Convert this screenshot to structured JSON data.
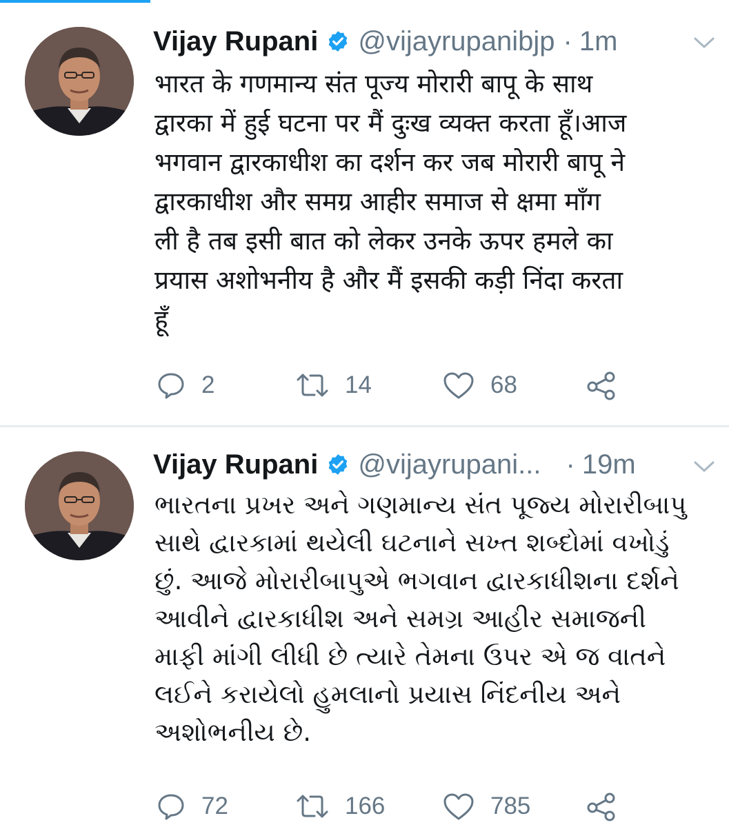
{
  "colors": {
    "accent": "#1da1f2",
    "text": "#14171a",
    "secondary": "#657786",
    "divider": "#e6ecf0"
  },
  "icons": {
    "verified": "verified-badge-icon",
    "menu": "chevron-down-icon",
    "reply": "reply-icon",
    "retweet": "retweet-icon",
    "like": "heart-icon",
    "share": "share-icon"
  },
  "tweets": [
    {
      "name": "Vijay Rupani",
      "handle": "@vijayrupanibjp",
      "separator": "·",
      "time": "1m",
      "lines": [
        "भारत के गणमान्य संत पूज्य मोरारी बापू के साथ",
        "द्वारका में हुई घटना पर मैं दुःख व्यक्त करता हूँ।आज",
        "भगवान द्वारकाधीश का दर्शन कर जब मोरारी बापू ने",
        "द्वारकाधीश और समग्र आहीर समाज से क्षमा माँग",
        "ली है तब इसी बात को लेकर उनके ऊपर हमले का",
        "प्रयास अशोभनीय है और मैं इसकी कड़ी निंदा करता",
        "हूँ"
      ],
      "replies": "2",
      "retweets": "14",
      "likes": "68"
    },
    {
      "name": "Vijay Rupani",
      "handle": "@vijayrupani...",
      "separator": "·",
      "time": "19m",
      "lines": [
        "ભારતના પ્રખર અને ગણમાન્ય સંત પૂજ્ય મોરારીબાપુ",
        "સાથે દ્વારકામાં થયેલી ઘટનાને સખ્ત શબ્દોમાં વખોડું",
        "છું. આજે મોરારીબાપુએ ભગવાન દ્વારકાધીશના દર્શને",
        "આવીને દ્વારકાધીશ અને સમગ્ર આહીર સમાજની",
        "માફી માંગી લીધી છે ત્યારે તેમના ઉપર એ જ વાતને",
        "લઈને કરાયેલો હુમલાનો પ્રયાસ નિંદનીય અને",
        "અશોભનીય છે."
      ],
      "replies": "72",
      "retweets": "166",
      "likes": "785"
    }
  ]
}
